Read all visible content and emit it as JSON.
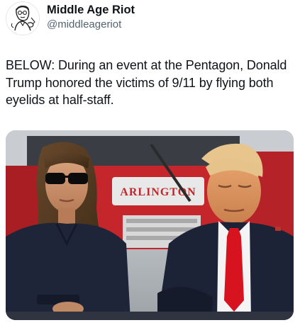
{
  "author": {
    "display_name": "Middle Age Riot",
    "handle": "@middleageriot",
    "avatar_icon": "vintage-man-illustration-icon"
  },
  "post": {
    "text": "BELOW: During an event at the Pentagon, Donald Trump honored the victims of 9/11 by flying both eyelids at half-staff."
  },
  "media": {
    "type": "photo",
    "truck_text": "ARLINGTON",
    "colors": {
      "fire_truck": "#c4262b",
      "tie": "#d7131f",
      "suit": "#1d2336"
    }
  }
}
